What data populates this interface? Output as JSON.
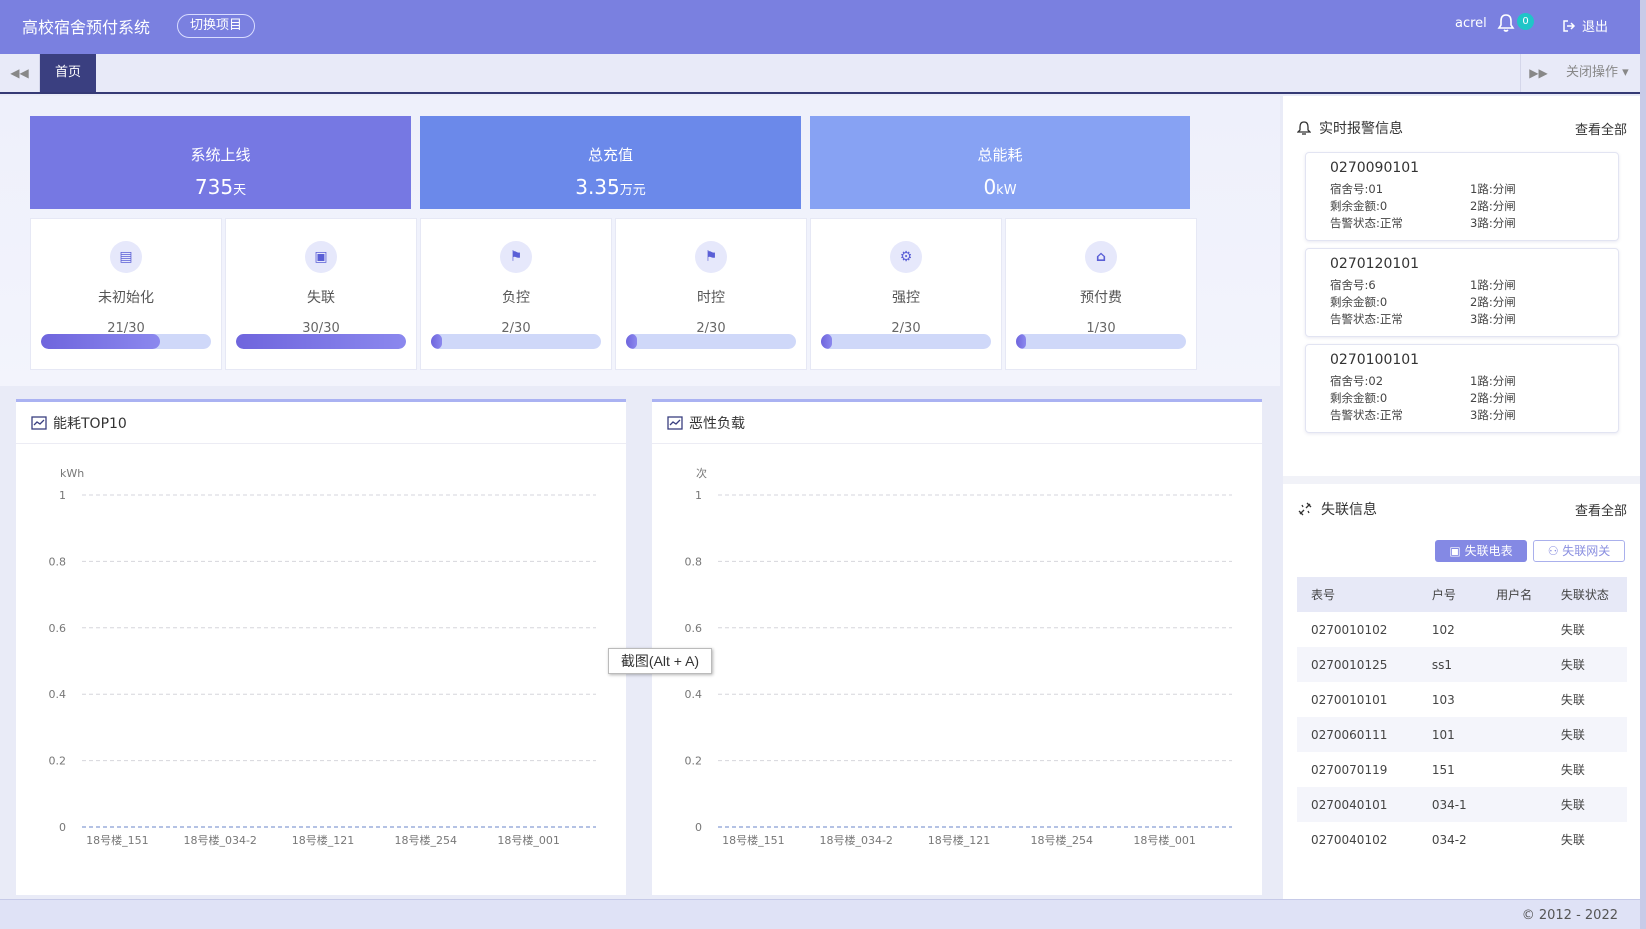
{
  "header": {
    "title": "高校宿舍预付系统",
    "switch_label": "切换项目",
    "user": "acrel",
    "bell_count": "0",
    "logout_label": "退出"
  },
  "tabs": {
    "home": "首页",
    "close_ops": "关闭操作"
  },
  "stats": [
    {
      "title": "系统上线",
      "value": "735",
      "unit": "天",
      "color": "#7678e3"
    },
    {
      "title": "总充值",
      "value": "3.35",
      "unit": "万元",
      "color": "#6b89ea"
    },
    {
      "title": "总能耗",
      "value": "0",
      "unit": "kW",
      "color": "#87a2f3"
    }
  ],
  "status_cards": [
    {
      "label": "未初始化",
      "count": "21/30",
      "ratio": 0.7,
      "icon": "card-icon"
    },
    {
      "label": "失联",
      "count": "30/30",
      "ratio": 1.0,
      "icon": "meter-icon"
    },
    {
      "label": "负控",
      "count": "2/30",
      "ratio": 0.067,
      "icon": "flag-icon"
    },
    {
      "label": "时控",
      "count": "2/30",
      "ratio": 0.067,
      "icon": "flag-icon"
    },
    {
      "label": "强控",
      "count": "2/30",
      "ratio": 0.067,
      "icon": "gears-icon"
    },
    {
      "label": "预付费",
      "count": "1/30",
      "ratio": 0.033,
      "icon": "home-icon"
    }
  ],
  "panels": {
    "energy_title": "能耗TOP10",
    "overload_title": "恶性负载",
    "tooltip": "截图(Alt + A)"
  },
  "chart_data": [
    {
      "type": "bar",
      "title": "能耗TOP10",
      "ylabel": "kWh",
      "categories": [
        "18号楼_151",
        "18号楼_034-2",
        "18号楼_121",
        "18号楼_254",
        "18号楼_001"
      ],
      "values": [
        0,
        0,
        0,
        0,
        0
      ],
      "ylim": [
        0,
        1
      ],
      "yticks": [
        "0",
        "0.2",
        "0.4",
        "0.6",
        "0.8",
        "1"
      ],
      "grid": true
    },
    {
      "type": "bar",
      "title": "恶性负载",
      "ylabel": "次",
      "categories": [
        "18号楼_151",
        "18号楼_034-2",
        "18号楼_121",
        "18号楼_254",
        "18号楼_001"
      ],
      "values": [
        0,
        0,
        0,
        0,
        0
      ],
      "ylim": [
        0,
        1
      ],
      "yticks": [
        "0",
        "0.2",
        "0.4",
        "0.6",
        "0.8",
        "1"
      ],
      "grid": true
    }
  ],
  "alarms": {
    "title": "实时报警信息",
    "more": "查看全部",
    "items": [
      {
        "id": "0270090101",
        "room": "宿舍号:01",
        "balance": "剩余金额:0",
        "status": "告警状态:正常",
        "r1": "1路:分闸",
        "r2": "2路:分闸",
        "r3": "3路:分闸"
      },
      {
        "id": "0270120101",
        "room": "宿舍号:6",
        "balance": "剩余金额:0",
        "status": "告警状态:正常",
        "r1": "1路:分闸",
        "r2": "2路:分闸",
        "r3": "3路:分闸"
      },
      {
        "id": "0270100101",
        "room": "宿舍号:02",
        "balance": "剩余金额:0",
        "status": "告警状态:正常",
        "r1": "1路:分闸",
        "r2": "2路:分闸",
        "r3": "3路:分闸"
      }
    ]
  },
  "lost": {
    "title": "失联信息",
    "more": "查看全部",
    "btn_meter": "失联电表",
    "btn_gateway": "失联网关",
    "columns": [
      "表号",
      "户号",
      "用户名",
      "失联状态"
    ],
    "rows": [
      [
        "0270010102",
        "102",
        "",
        "失联"
      ],
      [
        "0270010125",
        "ss1",
        "",
        "失联"
      ],
      [
        "0270010101",
        "103",
        "",
        "失联"
      ],
      [
        "0270060111",
        "101",
        "",
        "失联"
      ],
      [
        "0270070119",
        "151",
        "",
        "失联"
      ],
      [
        "0270040101",
        "034-1",
        "",
        "失联"
      ],
      [
        "0270040102",
        "034-2",
        "",
        "失联"
      ]
    ]
  },
  "footer": "© 2012 - 2022"
}
